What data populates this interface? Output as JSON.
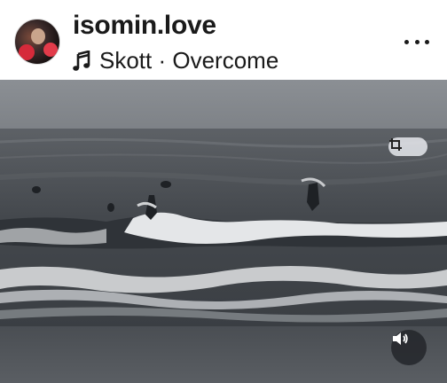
{
  "post": {
    "username": "isomin.love",
    "audio_track": "Skott · Overcome",
    "avatar_icon": "profile-photo",
    "more_icon": "ellipsis-horizontal-icon",
    "music_icon": "music-note-icon"
  },
  "media": {
    "type": "video",
    "description_icon": "crop-icon",
    "sound_icon": "speaker-icon",
    "colors": {
      "sky": "#8d9196",
      "sea": "#3e4247",
      "foam": "#e8eaec"
    }
  }
}
